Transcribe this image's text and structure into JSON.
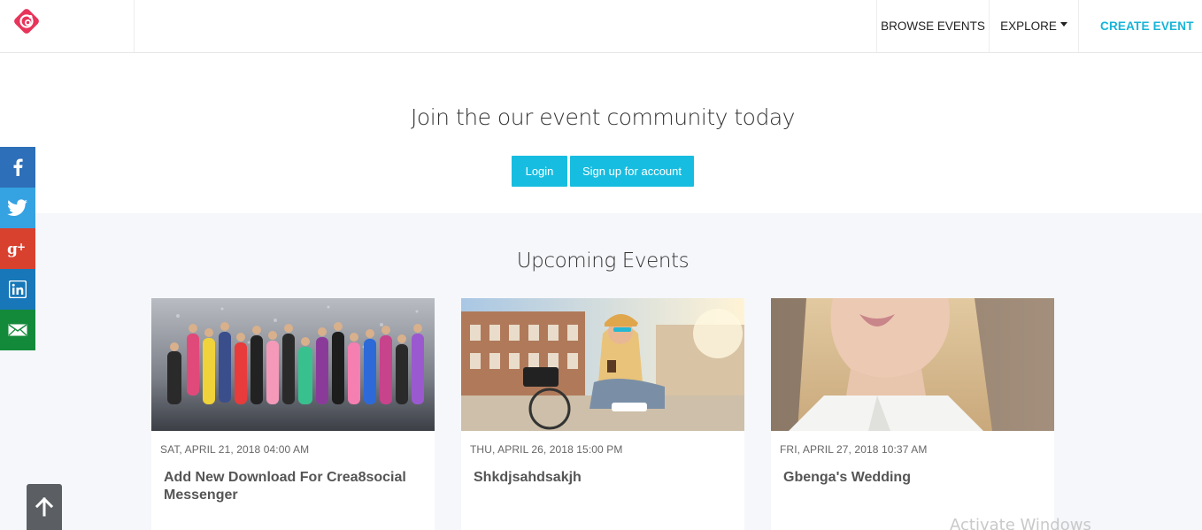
{
  "nav": {
    "browse_label": "BROWSE EVENTS",
    "explore_label": "EXPLORE",
    "create_label": "CREATE EVENT"
  },
  "hero": {
    "title": "Join the our event community today",
    "login_label": "Login",
    "signup_label": "Sign up for account"
  },
  "upcoming": {
    "title": "Upcoming Events",
    "events": [
      {
        "date": "SAT, APRIL 21, 2018 04:00 AM",
        "title": "Add New Download For Crea8social Messenger"
      },
      {
        "date": "THU, APRIL 26, 2018 15:00 PM",
        "title": "Shkdjsahdsakjh"
      },
      {
        "date": "FRI, APRIL 27, 2018 10:37 AM",
        "title": "Gbenga's Wedding"
      }
    ]
  },
  "social": {
    "items": [
      "facebook-icon",
      "twitter-icon",
      "google-plus-icon",
      "linkedin-icon",
      "email-icon"
    ]
  },
  "colors": {
    "accent": "#16b4d8",
    "button": "#17bde0",
    "section_bg": "#f6f7fb",
    "logo": "#e8345b"
  },
  "watermark": "Activate Windows"
}
